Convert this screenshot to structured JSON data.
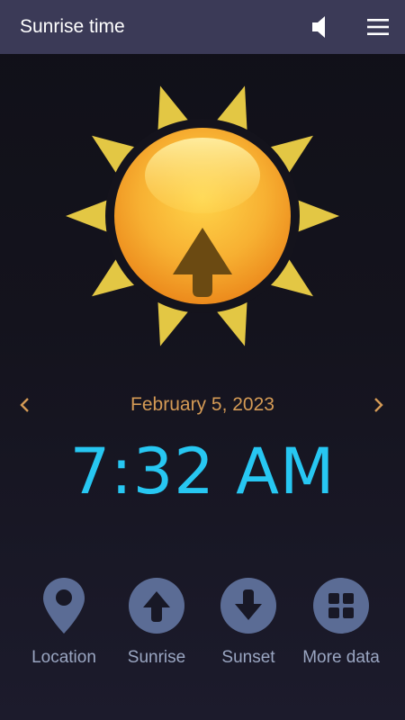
{
  "app_bar": {
    "title": "Sunrise time",
    "sound_icon": "speaker-icon",
    "menu_icon": "hamburger-menu-icon"
  },
  "hero": {
    "icon": "sunrise-sun-icon",
    "arrow_icon": "up-arrow-icon"
  },
  "date_nav": {
    "prev_icon": "chevron-left-icon",
    "date": "February 5, 2023",
    "next_icon": "chevron-right-icon"
  },
  "time": "7:32 AM",
  "bottom_nav": [
    {
      "label": "Location",
      "icon": "location-pin-icon"
    },
    {
      "label": "Sunrise",
      "icon": "arrow-up-circle-icon"
    },
    {
      "label": "Sunset",
      "icon": "arrow-down-circle-icon"
    },
    {
      "label": "More data",
      "icon": "grid-icon"
    }
  ],
  "colors": {
    "app_bar": "#3b3a57",
    "background": "#14131d",
    "date_text": "#d49a55",
    "time_text": "#27c7f2",
    "nav_icon": "#5b6c95",
    "nav_label": "#9aa6c2",
    "sun_rays": "#e3c744",
    "sun_body": "#f2a52c"
  }
}
